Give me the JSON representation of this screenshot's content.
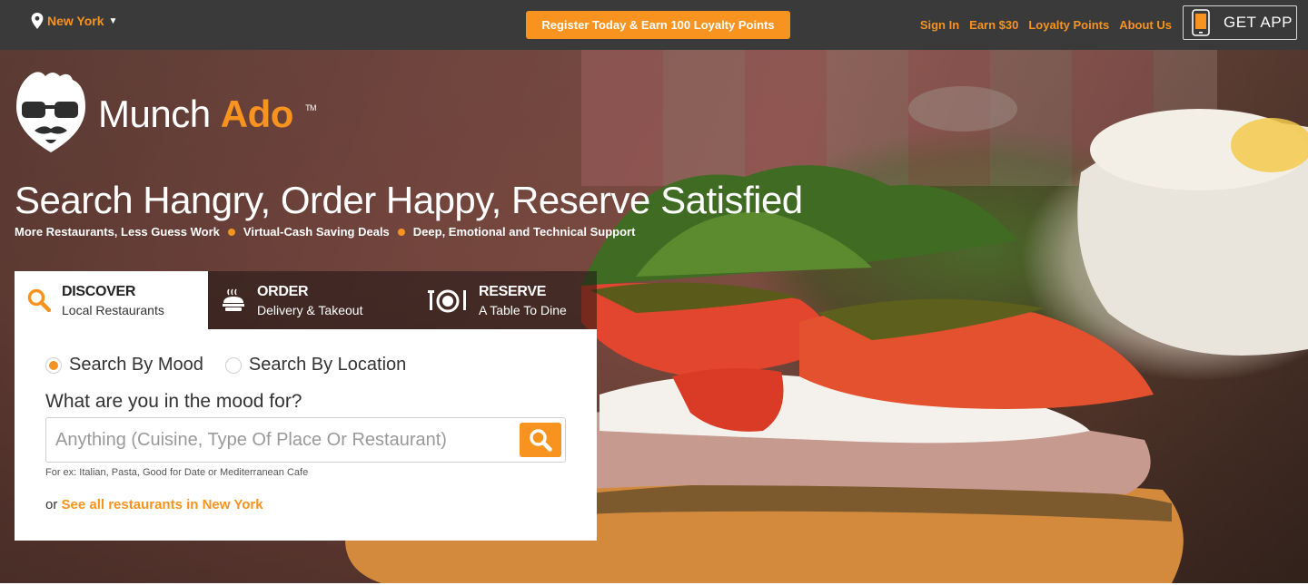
{
  "topbar": {
    "city": "New York",
    "register_button": "Register Today & Earn 100 Loyalty Points",
    "links": [
      "Sign In",
      "Earn $30",
      "Loyalty Points",
      "About Us"
    ],
    "get_app": "GET APP"
  },
  "brand": {
    "name_first": "Munch",
    "name_second": "Ado",
    "trademark": "TM"
  },
  "hero": {
    "headline": "Search Hangry, Order Happy, Reserve Satisfied",
    "taglines": [
      "More Restaurants, Less Guess Work",
      "Virtual-Cash Saving Deals",
      "Deep, Emotional and Technical Support"
    ]
  },
  "tabs": [
    {
      "title": "DISCOVER",
      "subtitle": "Local Restaurants",
      "icon": "search-icon",
      "active": true
    },
    {
      "title": "ORDER",
      "subtitle": "Delivery & Takeout",
      "icon": "takeout-icon",
      "active": false
    },
    {
      "title": "RESERVE",
      "subtitle": "A Table To Dine",
      "icon": "plate-cutlery-icon",
      "active": false
    }
  ],
  "search": {
    "modes": [
      {
        "label": "Search By Mood",
        "selected": true
      },
      {
        "label": "Search By Location",
        "selected": false
      }
    ],
    "prompt": "What are you in the mood for?",
    "placeholder": "Anything (Cuisine, Type Of Place Or Restaurant)",
    "example": "For ex: Italian, Pasta, Good for Date or Mediterranean Cafe",
    "see_all_prefix": "or",
    "see_all_link": "See all restaurants in New York"
  },
  "colors": {
    "accent": "#f7931e",
    "topbar_bg": "#3a3a3a"
  }
}
